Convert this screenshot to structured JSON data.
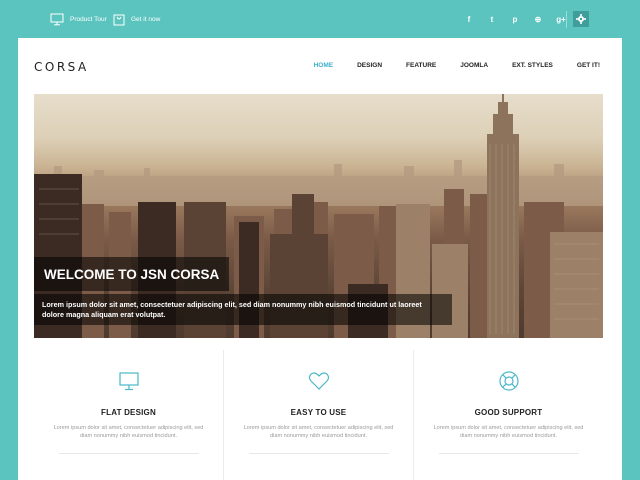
{
  "topbar": {
    "links": [
      {
        "label": "Product Tour",
        "icon": "monitor-icon"
      },
      {
        "label": "Get it now",
        "icon": "bag-icon"
      }
    ],
    "socials": [
      {
        "glyph": "f",
        "icon": "facebook-icon"
      },
      {
        "glyph": "t",
        "icon": "twitter-icon"
      },
      {
        "glyph": "p",
        "icon": "pinterest-icon"
      },
      {
        "glyph": "⊕",
        "icon": "dribbble-icon"
      },
      {
        "glyph": "g+",
        "icon": "google-plus-icon"
      }
    ],
    "settings_icon": "gear-icon"
  },
  "header": {
    "logo": "CORSA",
    "nav": [
      "HOME",
      "DESIGN",
      "FEATURE",
      "JOOMLA",
      "EXT. STYLES",
      "GET IT!"
    ],
    "active_nav": "HOME"
  },
  "hero": {
    "title": "WELCOME TO JSN CORSA",
    "text": "Lorem ipsum dolor sit amet, consectetuer adipiscing elit, sed diam nonummy nibh euismod tincidunt ut laoreet dolore magna aliquam erat volutpat."
  },
  "features": [
    {
      "icon": "monitor-icon",
      "title": "FLAT DESIGN",
      "desc": "Lorem ipsum dolor sit amet, consectetuer adipiscing elit, sed diam nonummy nibh euismod tincidunt."
    },
    {
      "icon": "heart-icon",
      "title": "EASY TO USE",
      "desc": "Lorem ipsum dolor sit amet, consectetuer adipiscing elit, sed diam nonummy nibh euismod tincidunt."
    },
    {
      "icon": "lifebuoy-icon",
      "title": "GOOD SUPPORT",
      "desc": "Lorem ipsum dolor sit amet, consectetuer adipiscing elit, sed diam nonummy nibh euismod tincidunt."
    }
  ],
  "colors": {
    "page_bg": "#5bc4bf",
    "accent": "#3cb0c9",
    "icon_teal": "#4ab8c7",
    "settings_button": "#3f9e9a"
  }
}
